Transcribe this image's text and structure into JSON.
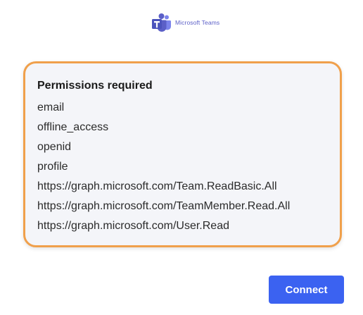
{
  "brand": {
    "name": "Microsoft Teams",
    "logo_icon": "microsoft-teams-logo",
    "color": "#5b5fc7"
  },
  "permissions": {
    "title": "Permissions required",
    "items": [
      "email",
      "offline_access",
      "openid",
      "profile",
      "https://graph.microsoft.com/Team.ReadBasic.All",
      "https://graph.microsoft.com/TeamMember.Read.All",
      "https://graph.microsoft.com/User.Read"
    ],
    "border_color": "#f0a04b",
    "background": "#f4f5f9"
  },
  "actions": {
    "connect_label": "Connect",
    "connect_color": "#3b62f1"
  }
}
